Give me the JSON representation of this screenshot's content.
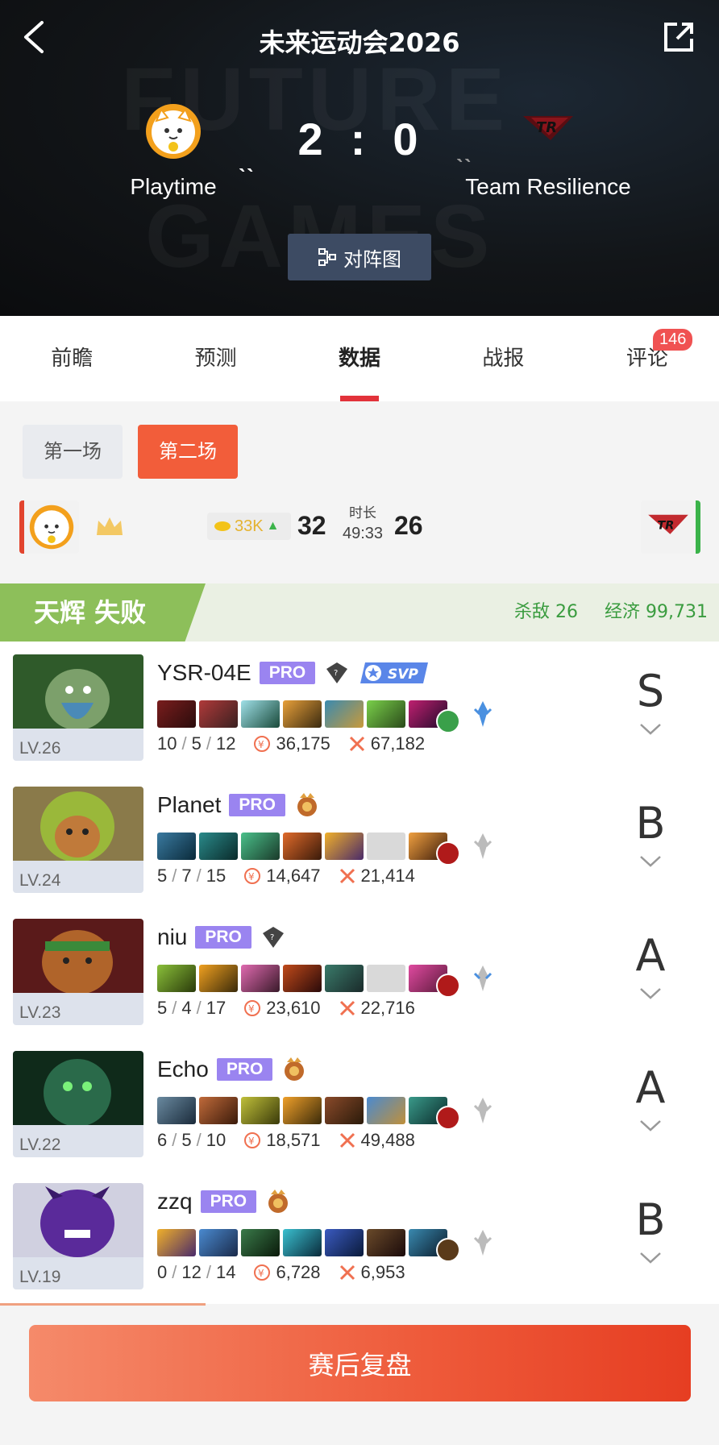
{
  "header": {
    "title": "未来运动会2026",
    "team_left": "Playtime",
    "team_right": "Team Resilience",
    "score_left": "2",
    "score_sep": ":",
    "score_right": "0",
    "bracket_label": "对阵图",
    "back_icon": "chevron-left-icon",
    "share_icon": "share-external-icon"
  },
  "tabs": [
    {
      "label": "前瞻"
    },
    {
      "label": "预测"
    },
    {
      "label": "数据",
      "active": true
    },
    {
      "label": "战报"
    },
    {
      "label": "评论",
      "badge": "146"
    }
  ],
  "games": [
    {
      "label": "第一场"
    },
    {
      "label": "第二场",
      "active": true
    }
  ],
  "summary": {
    "gold_lead": "33K",
    "kills_left": "32",
    "duration_label": "时长",
    "duration": "49:33",
    "kills_right": "26"
  },
  "side": {
    "title": "天辉 失败",
    "kills": "杀敌 26",
    "economy": "经济 99,731"
  },
  "players": [
    {
      "name": "YSR-04E",
      "pro": "PRO",
      "level": "LV.26",
      "kills": "10",
      "deaths": "5",
      "assists": "12",
      "gold": "36,175",
      "damage": "67,182",
      "grade": "S",
      "rank_icon": "immortal-rank-icon",
      "svp": "SVP"
    },
    {
      "name": "Planet",
      "pro": "PRO",
      "level": "LV.24",
      "kills": "5",
      "deaths": "7",
      "assists": "15",
      "gold": "14,647",
      "damage": "21,414",
      "grade": "B",
      "rank_icon": "divine-rank-icon"
    },
    {
      "name": "niu",
      "pro": "PRO",
      "level": "LV.23",
      "kills": "5",
      "deaths": "4",
      "assists": "17",
      "gold": "23,610",
      "damage": "22,716",
      "grade": "A",
      "rank_icon": "immortal-rank-icon"
    },
    {
      "name": "Echo",
      "pro": "PRO",
      "level": "LV.22",
      "kills": "6",
      "deaths": "5",
      "assists": "10",
      "gold": "18,571",
      "damage": "49,488",
      "grade": "A",
      "rank_icon": "divine-rank-icon"
    },
    {
      "name": "zzq",
      "pro": "PRO",
      "level": "LV.19",
      "kills": "0",
      "deaths": "12",
      "assists": "14",
      "gold": "6,728",
      "damage": "6,953",
      "grade": "B",
      "rank_icon": "divine-rank-icon"
    }
  ],
  "bottom": {
    "review_label": "赛后复盘"
  },
  "colors": {
    "accent": "#e2323a",
    "game_active": "#f25d3a",
    "radiant_flag": "#8dbf5a",
    "radiant_text": "#3a9c3f",
    "pro_badge": "#9a84f0",
    "button_gradient_end": "#e63e22"
  }
}
